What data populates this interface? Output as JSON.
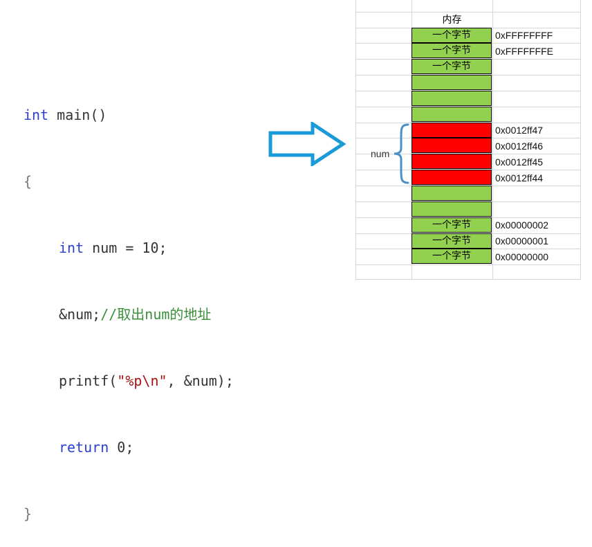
{
  "code": {
    "line1_kw": "int",
    "line1_rest": " main()",
    "line2": "{",
    "line3_kw": "int",
    "line3_rest": " num = 10;",
    "line4_code": "&num;",
    "line4_comment": "//取出num的地址",
    "line5_fn": "printf(",
    "line5_str": "\"%p\\n\"",
    "line5_rest": ", &num);",
    "line6_kw": "return",
    "line6_rest": " 0;",
    "line7": "}"
  },
  "memory": {
    "title": "内存",
    "byte_label": "一个字节",
    "num_label": "num",
    "addr_top1": "0xFFFFFFFF",
    "addr_top2": "0xFFFFFFFE",
    "addr_num1": "0x0012ff47",
    "addr_num2": "0x0012ff46",
    "addr_num3": "0x0012ff45",
    "addr_num4": "0x0012ff44",
    "addr_bot1": "0x00000002",
    "addr_bot2": "0x00000001",
    "addr_bot3": "0x00000000"
  },
  "colors": {
    "green": "#92d050",
    "red": "#ff0000",
    "arrow": "#1a9ad6",
    "brace": "#4a90c8",
    "keyword": "#2a3fd0",
    "comment": "#3a8f3a",
    "string": "#a31515"
  }
}
